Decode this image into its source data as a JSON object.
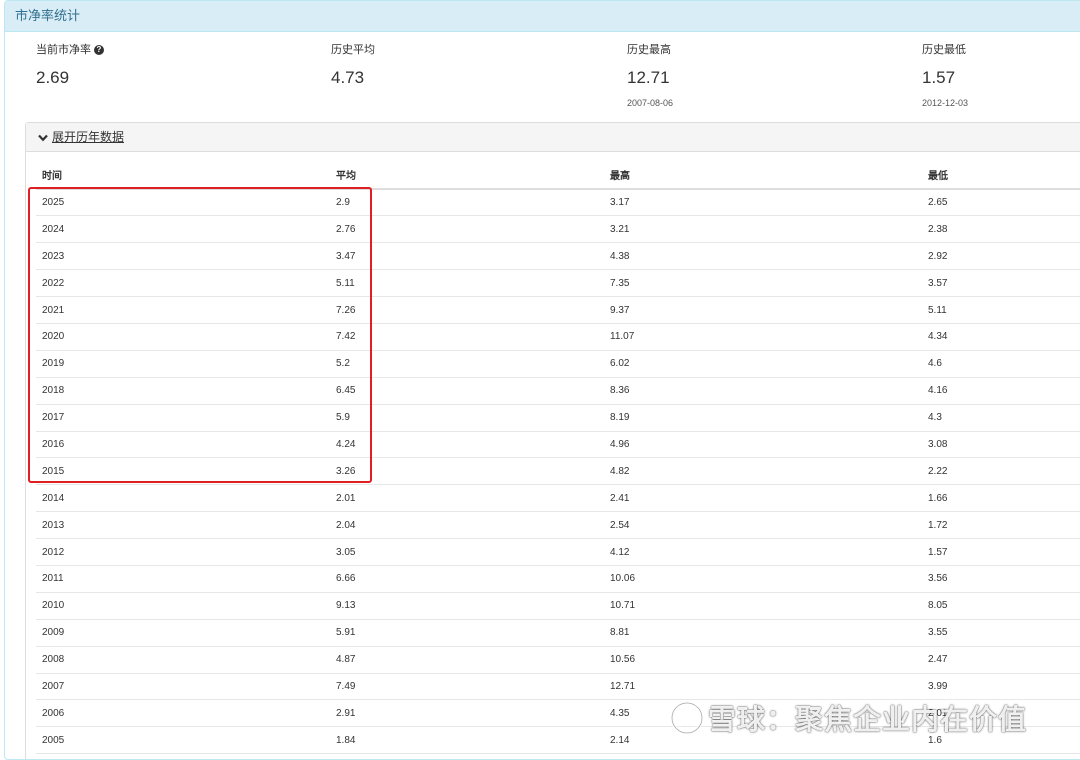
{
  "panel": {
    "title": "市净率统计"
  },
  "stats": {
    "current": {
      "label": "当前市净率",
      "value": "2.69"
    },
    "average": {
      "label": "历史平均",
      "value": "4.73"
    },
    "highest": {
      "label": "历史最高",
      "value": "12.71",
      "date": "2007-08-06"
    },
    "lowest": {
      "label": "历史最低",
      "value": "1.57",
      "date": "2012-12-03"
    }
  },
  "history": {
    "toggle_label": "展开历年数据",
    "columns": [
      "时间",
      "平均",
      "最高",
      "最低"
    ],
    "rows": [
      [
        "2025",
        "2.9",
        "3.17",
        "2.65"
      ],
      [
        "2024",
        "2.76",
        "3.21",
        "2.38"
      ],
      [
        "2023",
        "3.47",
        "4.38",
        "2.92"
      ],
      [
        "2022",
        "5.11",
        "7.35",
        "3.57"
      ],
      [
        "2021",
        "7.26",
        "9.37",
        "5.11"
      ],
      [
        "2020",
        "7.42",
        "11.07",
        "4.34"
      ],
      [
        "2019",
        "5.2",
        "6.02",
        "4.6"
      ],
      [
        "2018",
        "6.45",
        "8.36",
        "4.16"
      ],
      [
        "2017",
        "5.9",
        "8.19",
        "4.3"
      ],
      [
        "2016",
        "4.24",
        "4.96",
        "3.08"
      ],
      [
        "2015",
        "3.26",
        "4.82",
        "2.22"
      ],
      [
        "2014",
        "2.01",
        "2.41",
        "1.66"
      ],
      [
        "2013",
        "2.04",
        "2.54",
        "1.72"
      ],
      [
        "2012",
        "3.05",
        "4.12",
        "1.57"
      ],
      [
        "2011",
        "6.66",
        "10.06",
        "3.56"
      ],
      [
        "2010",
        "9.13",
        "10.71",
        "8.05"
      ],
      [
        "2009",
        "5.91",
        "8.81",
        "3.55"
      ],
      [
        "2008",
        "4.87",
        "10.56",
        "2.47"
      ],
      [
        "2007",
        "7.49",
        "12.71",
        "3.99"
      ],
      [
        "2006",
        "2.91",
        "4.35",
        "2.01"
      ],
      [
        "2005",
        "1.84",
        "2.14",
        "1.6"
      ]
    ]
  },
  "watermark": {
    "text": "雪球：聚焦企业内在价值"
  },
  "colors": {
    "highlight": "#e02020",
    "heading_bg": "#d9edf7",
    "heading_text": "#31708f"
  },
  "icons": {
    "help": "question-circle-icon",
    "toggle": "chevron-down-icon",
    "watermark": "snowball-logo-icon"
  }
}
